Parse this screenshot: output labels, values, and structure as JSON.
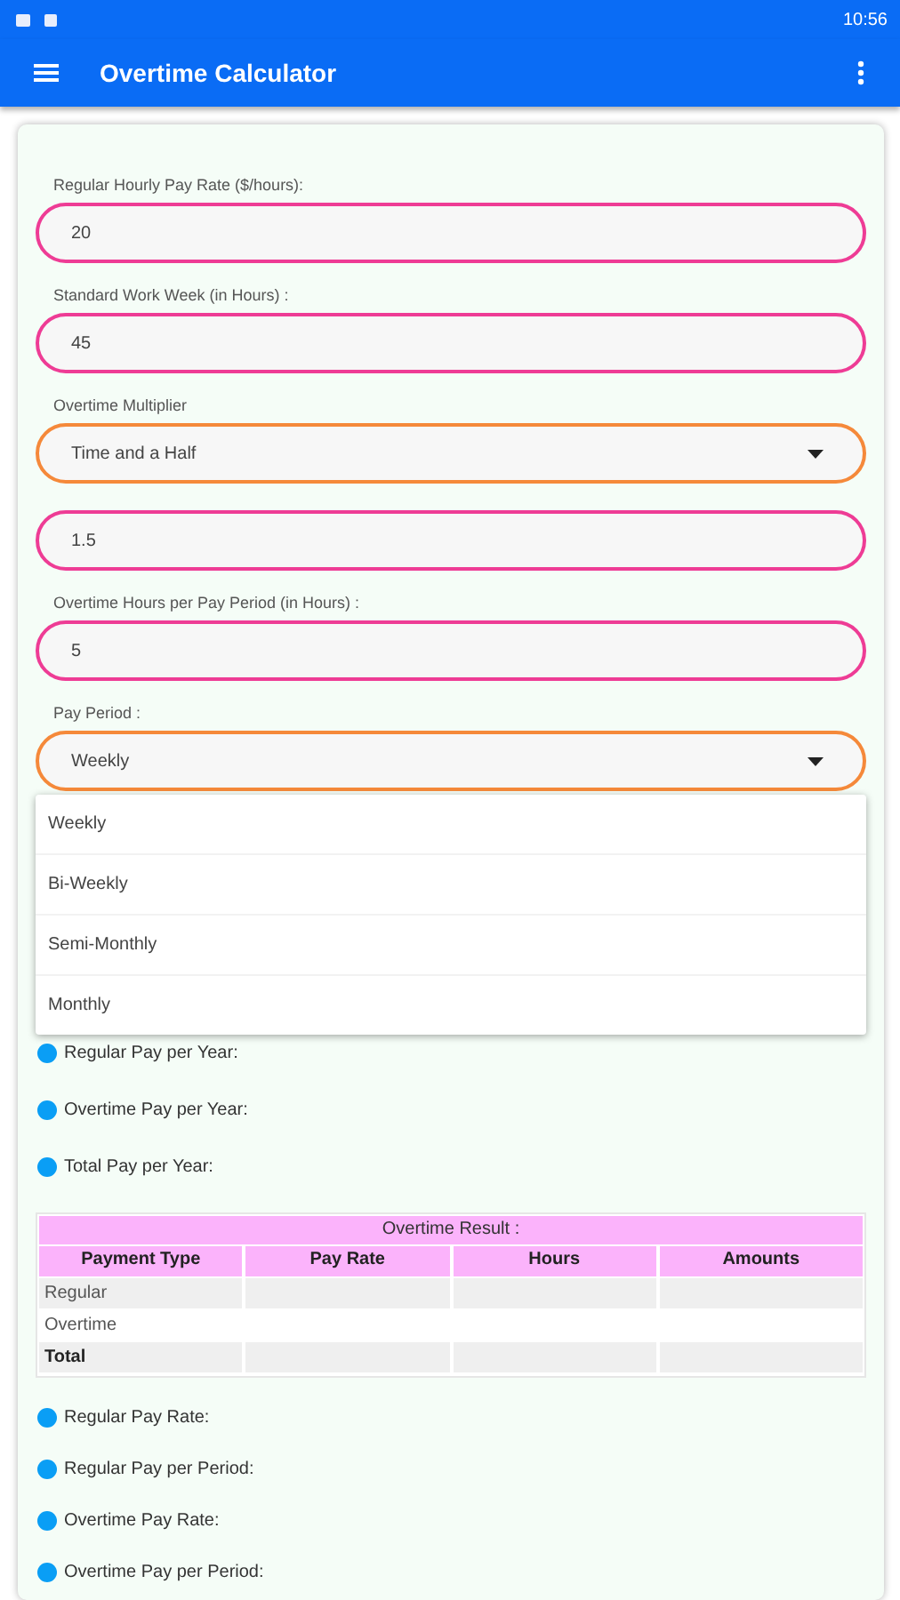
{
  "status_bar": {
    "time": "10:56"
  },
  "app_bar": {
    "title": "Overtime Calculator"
  },
  "form": {
    "fields": [
      {
        "kind": "input",
        "label": "Regular Hourly Pay Rate ($/hours):",
        "value": "20"
      },
      {
        "kind": "input",
        "label": "Standard Work Week (in Hours) :",
        "value": "45"
      },
      {
        "kind": "dropdown",
        "label": "Overtime Multiplier",
        "value": "Time and a Half"
      },
      {
        "kind": "input",
        "value": "1.5"
      },
      {
        "kind": "input",
        "label": "Overtime Hours per Pay Period (in Hours) :",
        "value": "5"
      },
      {
        "kind": "dropdown",
        "label": "Pay Period :",
        "value": "Weekly",
        "expanded": true,
        "options": [
          "Weekly",
          "Bi-Weekly",
          "Semi-Monthly",
          "Monthly"
        ]
      }
    ]
  },
  "year_results": [
    "Regular Pay per Year:",
    "Overtime Pay per Year:",
    "Total Pay per Year:"
  ],
  "table": {
    "title": "Overtime Result :",
    "columns": [
      "Payment Type",
      "Pay Rate",
      "Hours",
      "Amounts"
    ],
    "rows": [
      {
        "kind": "normal",
        "label": "Regular"
      },
      {
        "kind": "normal",
        "label": "Overtime"
      },
      {
        "kind": "total",
        "label": "Total"
      }
    ]
  },
  "period_results": [
    "Regular Pay Rate:",
    "Regular Pay per Period:",
    "Overtime Pay Rate:",
    "Overtime Pay per Period:"
  ]
}
